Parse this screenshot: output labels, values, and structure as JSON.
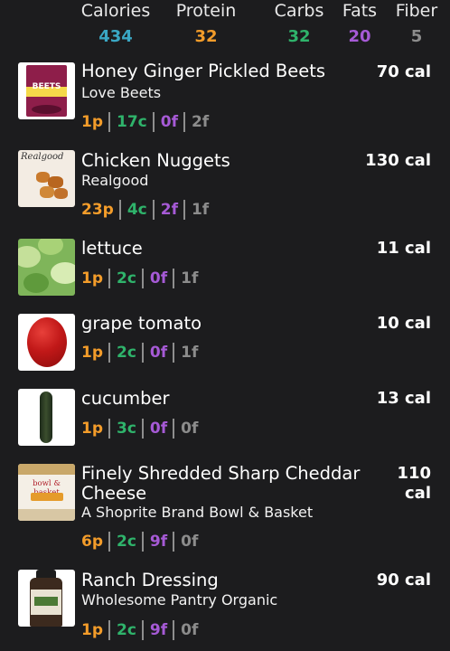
{
  "summary": {
    "calories": {
      "label": "Calories",
      "value": "434"
    },
    "protein": {
      "label": "Protein",
      "value": "32"
    },
    "carbs": {
      "label": "Carbs",
      "value": "32"
    },
    "fats": {
      "label": "Fats",
      "value": "20"
    },
    "fiber": {
      "label": "Fiber",
      "value": "5"
    }
  },
  "colors": {
    "calories": "#3aa7c4",
    "protein": "#f39c2a",
    "carbs": "#2fb36b",
    "fats": "#a65ad6",
    "fiber": "#8c8c8c"
  },
  "foods": [
    {
      "name": "Honey Ginger Pickled Beets",
      "brand": "Love Beets",
      "calories": "70 cal",
      "protein": "1p",
      "carbs": "17c",
      "fat": "0f",
      "fiber": "2f",
      "image_text": "BEETS"
    },
    {
      "name": "Chicken Nuggets",
      "brand": "Realgood",
      "calories": "130 cal",
      "protein": "23p",
      "carbs": "4c",
      "fat": "2f",
      "fiber": "1f",
      "image_text": "Realgood"
    },
    {
      "name": "lettuce",
      "brand": "",
      "calories": "11 cal",
      "protein": "1p",
      "carbs": "2c",
      "fat": "0f",
      "fiber": "1f"
    },
    {
      "name": "grape tomato",
      "brand": "",
      "calories": "10 cal",
      "protein": "1p",
      "carbs": "2c",
      "fat": "0f",
      "fiber": "1f"
    },
    {
      "name": "cucumber",
      "brand": "",
      "calories": "13 cal",
      "protein": "1p",
      "carbs": "3c",
      "fat": "0f",
      "fiber": "0f"
    },
    {
      "name": "Finely Shredded Sharp Cheddar Cheese",
      "brand": "A Shoprite Brand Bowl & Basket",
      "calories": "110 cal",
      "protein": "6p",
      "carbs": "2c",
      "fat": "9f",
      "fiber": "0f",
      "image_text": "bowl & basket"
    },
    {
      "name": "Ranch Dressing",
      "brand": "Wholesome Pantry Organic",
      "calories": "90 cal",
      "protein": "1p",
      "carbs": "2c",
      "fat": "9f",
      "fiber": "0f"
    }
  ]
}
